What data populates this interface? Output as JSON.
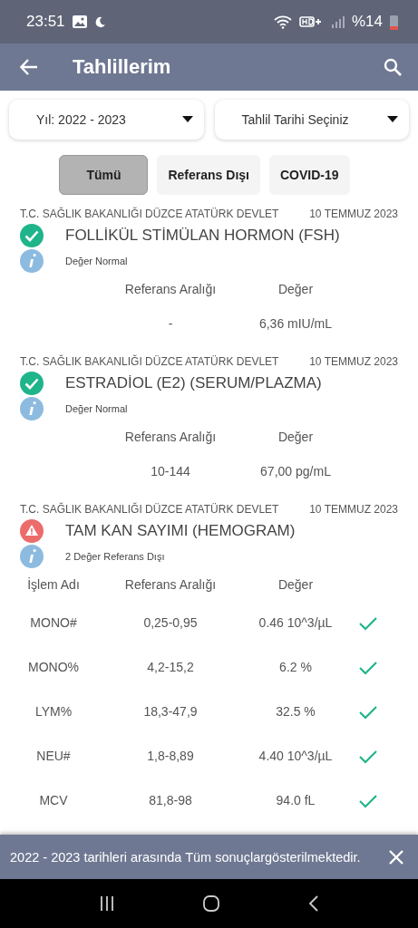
{
  "status_bar": {
    "time": "23:51",
    "battery": "%14"
  },
  "app_bar": {
    "title": "Tahlillerim"
  },
  "filters": [
    {
      "label": "Yıl: 2022 - 2023"
    },
    {
      "label": "Tahlil Tarihi Seçiniz"
    }
  ],
  "chips": [
    {
      "label": "Tümü",
      "selected": true
    },
    {
      "label": "Referans Dışı",
      "selected": false
    },
    {
      "label": "COVID-19",
      "selected": false
    }
  ],
  "results": [
    {
      "hospital": "T.C. SAĞLIK BAKANLIĞI DÜZCE ATATÜRK DEVLET",
      "date": "10 TEMMUZ 2023",
      "test": "FOLLİKÜL STİMÜLAN HORMON (FSH)",
      "kind": "normal",
      "summary": "Değer Normal",
      "columns": [
        "Referans Aralığı",
        "Değer"
      ],
      "rows": [
        {
          "range": "-",
          "value": "6,36 mIU/mL"
        }
      ]
    },
    {
      "hospital": "T.C. SAĞLIK BAKANLIĞI DÜZCE ATATÜRK DEVLET",
      "date": "10 TEMMUZ 2023",
      "test": "ESTRADİOL (E2) (SERUM/PLAZMA)",
      "kind": "normal",
      "summary": "Değer Normal",
      "columns": [
        "Referans Aralığı",
        "Değer"
      ],
      "rows": [
        {
          "range": "10-144",
          "value": "67,00 pg/mL"
        }
      ]
    },
    {
      "hospital": "T.C. SAĞLIK BAKANLIĞI DÜZCE ATATÜRK DEVLET",
      "date": "10 TEMMUZ 2023",
      "test": "TAM KAN SAYIMI (HEMOGRAM)",
      "kind": "warning",
      "summary": "2 Değer Referans Dışı",
      "columns": [
        "İşlem Adı",
        "Referans Aralığı",
        "Değer"
      ],
      "rows": [
        {
          "name": "MONO#",
          "range": "0,25-0,95",
          "value": "0.46 10^3/µL",
          "in_range": true
        },
        {
          "name": "MONO%",
          "range": "4,2-15,2",
          "value": "6.2 %",
          "in_range": true
        },
        {
          "name": "LYM%",
          "range": "18,3-47,9",
          "value": "32.5 %",
          "in_range": true
        },
        {
          "name": "NEU#",
          "range": "1,8-8,89",
          "value": "4.40 10^3/µL",
          "in_range": true
        },
        {
          "name": "MCV",
          "range": "81,8-98",
          "value": "94.0 fL",
          "in_range": true
        }
      ]
    }
  ],
  "snackbar": {
    "message": "2022 - 2023 tarihleri arasında Tüm sonuçlargösterilmektedir."
  }
}
